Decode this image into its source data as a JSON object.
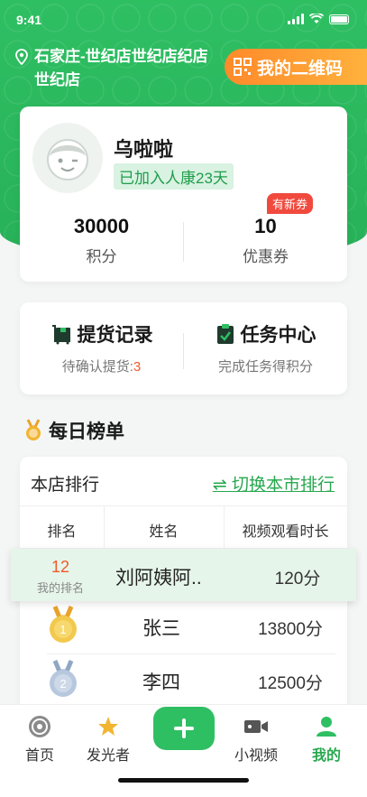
{
  "status_bar": {
    "time": "9:41"
  },
  "header": {
    "location": "石家庄-世纪店世纪店纪店世纪店",
    "qr_button": "我的二维码"
  },
  "profile": {
    "name": "乌啦啦",
    "joined": "已加入人康23天",
    "points_value": "30000",
    "points_label": "积分",
    "coupons_value": "10",
    "coupons_label": "优惠券",
    "coupon_badge": "有新券"
  },
  "tasks": {
    "pickup_title": "提货记录",
    "pickup_sub": "待确认提货:",
    "pickup_count": "3",
    "task_title": "任务中心",
    "task_sub": "完成任务得积分"
  },
  "ranking": {
    "title": "每日榜单",
    "store_rank": "本店排行",
    "switch_link": "⇌ 切换本市排行",
    "col_rank": "排名",
    "col_name": "姓名",
    "col_time": "视频观看时长",
    "mine": {
      "rank": "12",
      "rank_label": "我的排名",
      "name": "刘阿姨阿..",
      "time": "120分"
    },
    "rows": [
      {
        "medal": "1",
        "name": "张三",
        "time": "13800分"
      },
      {
        "medal": "2",
        "name": "李四",
        "time": "12500分"
      }
    ]
  },
  "tabbar": {
    "home": "首页",
    "shiner": "发光者",
    "video": "小视频",
    "mine": "我的"
  },
  "colors": {
    "brand_green": "#2fbf63",
    "accent_orange": "#f05a2a",
    "badge_red": "#f04a3e"
  }
}
